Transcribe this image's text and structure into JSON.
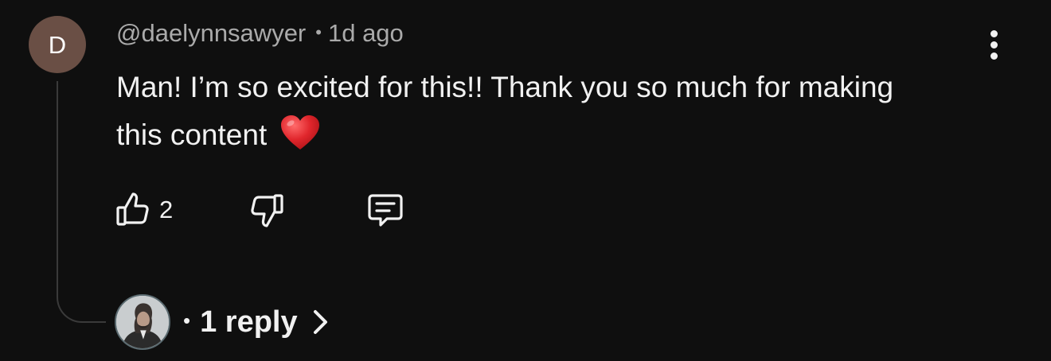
{
  "comment": {
    "avatar_letter": "D",
    "username": "@daelynnsawyer",
    "separator": "•",
    "timestamp": "1d ago",
    "text": "Man! I’m so excited for this!! Thank you so much for making this content",
    "emoji": "red-heart"
  },
  "actions": {
    "like_icon": "thumbs-up-icon",
    "like_count": "2",
    "dislike_icon": "thumbs-down-icon",
    "reply_icon": "comment-icon",
    "menu_icon": "more-vertical-icon"
  },
  "replies": {
    "avatar": "replier-avatar",
    "separator": "•",
    "label": "1 reply",
    "chevron_icon": "chevron-right-icon"
  },
  "colors": {
    "background": "#0f0f0f",
    "text_primary": "#f1f1f1",
    "text_secondary": "#aaaaaa",
    "avatar_bg": "#6a4f45",
    "thread_line": "#3a3a3a",
    "heart": "#e0262c"
  }
}
